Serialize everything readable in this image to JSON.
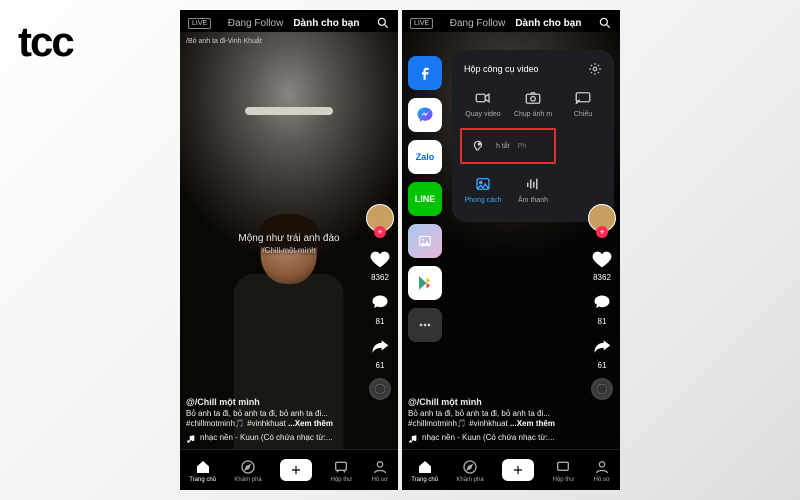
{
  "brand": "tcc",
  "topbar": {
    "live": "LIVE",
    "tab_follow": "Đang Follow",
    "tab_foryou": "Dành cho bạn"
  },
  "video": {
    "top_song": "/Bỏ anh ta đi-Vinh Khuất",
    "caption_line1": "Mộng như trái anh đào",
    "caption_line2": "/Chill một mình"
  },
  "sidebar": {
    "likes": "8362",
    "comments": "81",
    "shares": "61"
  },
  "meta": {
    "username": "@/Chill một mình",
    "desc": "Bỏ anh ta đi, bỏ anh ta đi, bỏ anh ta đi...",
    "tags": "#chillmotminh🎵 #vinhkhuat",
    "more": "...Xem thêm",
    "music": "nhạc nền - Kuun (Có chứa nhạc từ:..."
  },
  "nav": {
    "home": "Trang chủ",
    "discover": "Khám phá",
    "inbox": "Hộp thư",
    "profile": "Hồ sơ"
  },
  "share": {
    "zalo": "Zalo",
    "line": "LINE"
  },
  "tools": {
    "title": "Hộp công cụ video",
    "record": "Quay video",
    "screenshot": "Chụp ảnh m",
    "cast": "Chiếu",
    "shortcut_a": "h tắt",
    "shortcut_b": "Ph",
    "style": "Phong cách",
    "audio": "Âm thanh"
  }
}
